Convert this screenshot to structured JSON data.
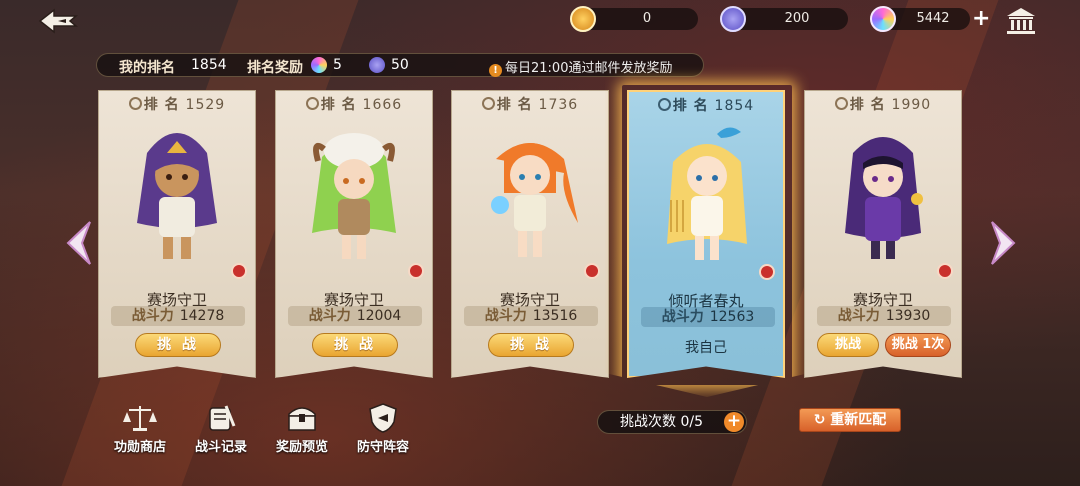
{
  "topbar": {
    "currencies": [
      {
        "icon": "medal-coin-icon",
        "value": "0",
        "color": "#e7a12a"
      },
      {
        "icon": "crossed-swords-coin-icon",
        "value": "200",
        "color": "#7a6fd6"
      },
      {
        "icon": "rainbow-gem-icon",
        "value": "5442",
        "color": "#c86ad8"
      }
    ],
    "plus": "+"
  },
  "info": {
    "my_rank_label": "我的排名",
    "my_rank_value": "1854",
    "reward_label": "排名奖励",
    "reward_gem": "5",
    "reward_coin": "50",
    "notice": "每日21:00通过邮件发放奖励",
    "notice_icon": "!"
  },
  "cards": [
    {
      "rank_label": "排 名",
      "rank": "1529",
      "name": "赛场守卫",
      "power_label": "战斗力",
      "power": "14278",
      "action": "挑 战"
    },
    {
      "rank_label": "排 名",
      "rank": "1666",
      "name": "赛场守卫",
      "power_label": "战斗力",
      "power": "12004",
      "action": "挑 战"
    },
    {
      "rank_label": "排 名",
      "rank": "1736",
      "name": "赛场守卫",
      "power_label": "战斗力",
      "power": "13516",
      "action": "挑 战"
    },
    {
      "rank_label": "排 名",
      "rank": "1854",
      "name": "倾听者春丸",
      "power_label": "战斗力",
      "power": "12563",
      "self_label": "我自己"
    },
    {
      "rank_label": "排 名",
      "rank": "1990",
      "name": "赛场守卫",
      "power_label": "战斗力",
      "power": "13930",
      "action": "挑战",
      "action2": "挑战 1次"
    }
  ],
  "bottom": {
    "items": [
      {
        "label": "功勋商店",
        "icon": "scales-icon"
      },
      {
        "label": "战斗记录",
        "icon": "scroll-icon"
      },
      {
        "label": "奖励预览",
        "icon": "treasure-chest-icon"
      },
      {
        "label": "防守阵容",
        "icon": "shield-icon"
      }
    ],
    "attempts": "挑战次数 0/5",
    "attempts_plus": "+",
    "rematch": "重新匹配"
  }
}
